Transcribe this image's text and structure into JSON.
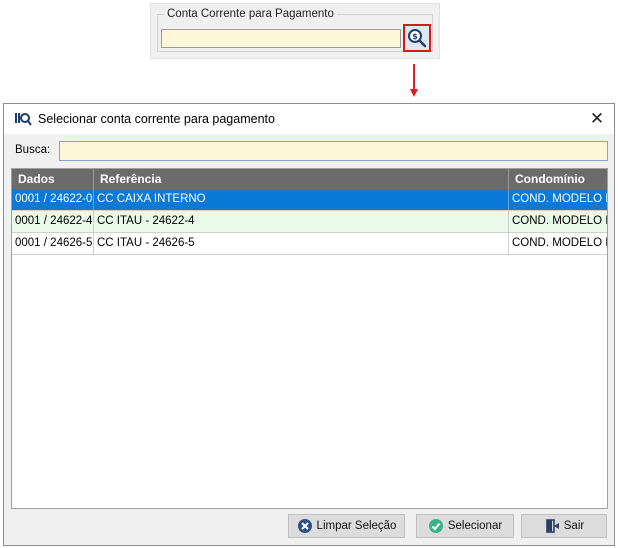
{
  "snippet": {
    "legend": "Conta Corrente para Pagamento",
    "field_value": ""
  },
  "dialog": {
    "title": "Selecionar conta corrente para pagamento",
    "close_glyph": "✕",
    "search": {
      "label": "Busca:",
      "value": ""
    },
    "table": {
      "columns": [
        "Dados",
        "Referência",
        "Condomínio"
      ],
      "rows": [
        {
          "dados": "0001 / 24622-0",
          "referencia": "CC CAIXA INTERNO",
          "condominio": "COND. MODELO I",
          "state": "selected"
        },
        {
          "dados": "0001 / 24622-4",
          "referencia": "CC ITAU - 24622-4",
          "condominio": "COND. MODELO I",
          "state": "alt"
        },
        {
          "dados": "0001 / 24626-5",
          "referencia": "CC ITAU - 24626-5",
          "condominio": "COND. MODELO I",
          "state": "normal"
        }
      ]
    },
    "buttons": {
      "clear": "Limpar Seleção",
      "select": "Selecionar",
      "exit": "Sair"
    }
  },
  "colors": {
    "selected_row": "#0a79d8",
    "alt_row": "#eafaea",
    "input_bg": "#fdf6d8",
    "highlight_border": "#d8171b",
    "header_bg": "#6b6b6b"
  },
  "icons": [
    "search-money-icon",
    "app-icon",
    "close-icon",
    "clear-icon",
    "check-icon",
    "exit-door-icon"
  ]
}
